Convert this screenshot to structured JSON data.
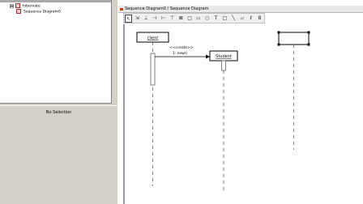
{
  "navigator": {
    "tree": {
      "root_label": "hibernate",
      "child_label": "Sequence Diagram0"
    },
    "selection_label": "No Selection"
  },
  "window": {
    "title": "Sequence Diagram0 / Sequence Diagram"
  },
  "toolbar": {
    "tools": [
      {
        "icon": "select-arrow-icon",
        "glyph": "↖",
        "active": true
      },
      {
        "icon": "broom-icon",
        "glyph": "⇲"
      },
      {
        "icon": "object-icon",
        "glyph": "⊥"
      },
      {
        "icon": "stimulus-call-icon",
        "glyph": "⊣"
      },
      {
        "icon": "stimulus-create-icon",
        "glyph": "⊢"
      },
      {
        "icon": "stimulus-return-icon",
        "glyph": "⊤"
      },
      {
        "icon": "stimulus-destroy-icon",
        "glyph": "⊠"
      },
      {
        "icon": "rectangle-icon",
        "glyph": "□"
      },
      {
        "icon": "rounded-rectangle-icon",
        "glyph": "▭"
      },
      {
        "icon": "ellipse-icon",
        "glyph": "○"
      },
      {
        "icon": "text-icon",
        "glyph": "T"
      },
      {
        "icon": "box-icon",
        "glyph": "□"
      },
      {
        "icon": "line-icon",
        "glyph": "╲"
      },
      {
        "icon": "polygon-icon",
        "glyph": "▱"
      },
      {
        "icon": "spline-icon",
        "glyph": "ℓ"
      },
      {
        "icon": "ink-icon",
        "glyph": "8"
      }
    ]
  },
  "diagram": {
    "objects": [
      {
        "name": "client",
        "label": "client"
      },
      {
        "name": "student",
        "label": "Student"
      },
      {
        "name": "new-object",
        "label": ""
      }
    ],
    "messages": [
      {
        "stereotype": "<<create>>",
        "label": "1: new()"
      }
    ]
  }
}
